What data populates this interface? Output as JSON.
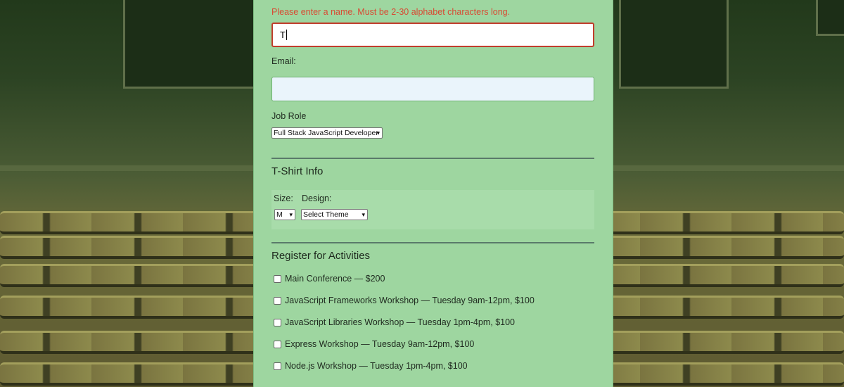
{
  "form": {
    "name_error": "Please enter a name. Must be 2-30 alphabet characters long.",
    "name_value": "T",
    "email_label": "Email:",
    "email_value": "",
    "job_role_label": "Job Role",
    "job_role_selected": "Full Stack JavaScript Developer"
  },
  "tshirt": {
    "title": "T-Shirt Info",
    "size_label": "Size:",
    "size_selected": "M",
    "design_label": "Design:",
    "design_selected": "Select Theme"
  },
  "activities": {
    "title": "Register for Activities",
    "items": [
      {
        "label": "Main Conference — $200"
      },
      {
        "label": "JavaScript Frameworks Workshop — Tuesday 9am-12pm, $100"
      },
      {
        "label": "JavaScript Libraries Workshop — Tuesday 1pm-4pm, $100"
      },
      {
        "label": "Express Workshop — Tuesday 9am-12pm, $100"
      },
      {
        "label": "Node.js Workshop — Tuesday 1pm-4pm, $100"
      }
    ]
  },
  "colors": {
    "panel": "#9ed6a0",
    "error": "#d84a33",
    "background_tint": "#2c4323"
  },
  "icons": {
    "select_arrow": "chevron-down-icon"
  }
}
